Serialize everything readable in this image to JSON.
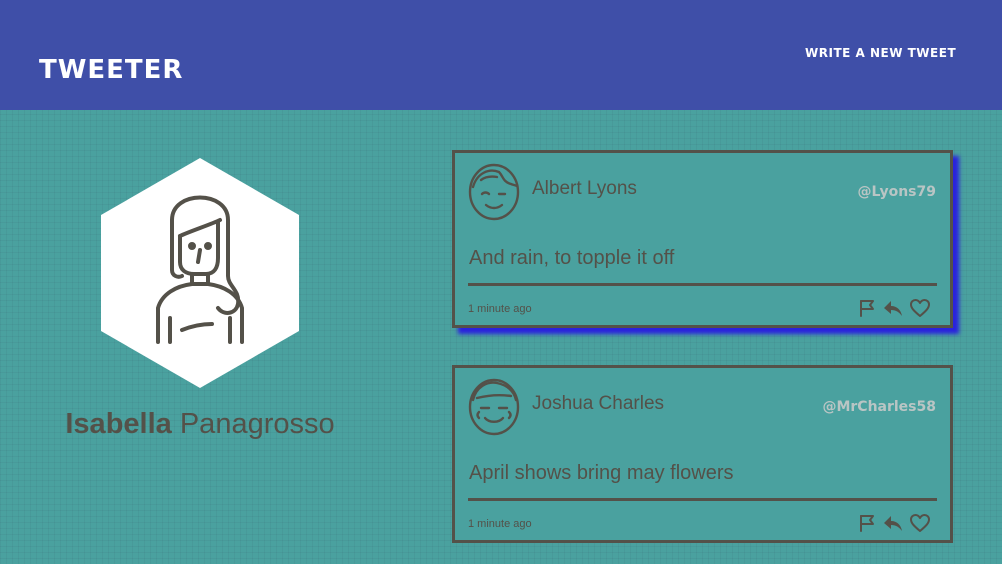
{
  "header": {
    "brand": "TWEETER",
    "new_tweet_label": "WRITE A NEW TWEET"
  },
  "profile": {
    "first_name": "Isabella",
    "last_name": "Panagrosso",
    "avatar_icon": "woman-avatar-icon"
  },
  "tweets": [
    {
      "author": "Albert Lyons",
      "handle": "@Lyons79",
      "text": "And rain, to topple it off",
      "time": "1 minute ago",
      "avatar_icon": "winking-man-avatar-icon"
    },
    {
      "author": "Joshua Charles",
      "handle": "@MrCharles58",
      "text": "April shows bring may flowers",
      "time": "1 minute ago",
      "avatar_icon": "smiling-man-avatar-icon"
    }
  ],
  "actions": [
    "flag-icon",
    "reply-icon",
    "heart-icon"
  ],
  "colors": {
    "header_bg": "#3f4fa8",
    "page_bg": "#4aa19f",
    "ink": "#545149",
    "handle": "#b9c5c4",
    "tweet_shadow": "#2a22dd"
  }
}
